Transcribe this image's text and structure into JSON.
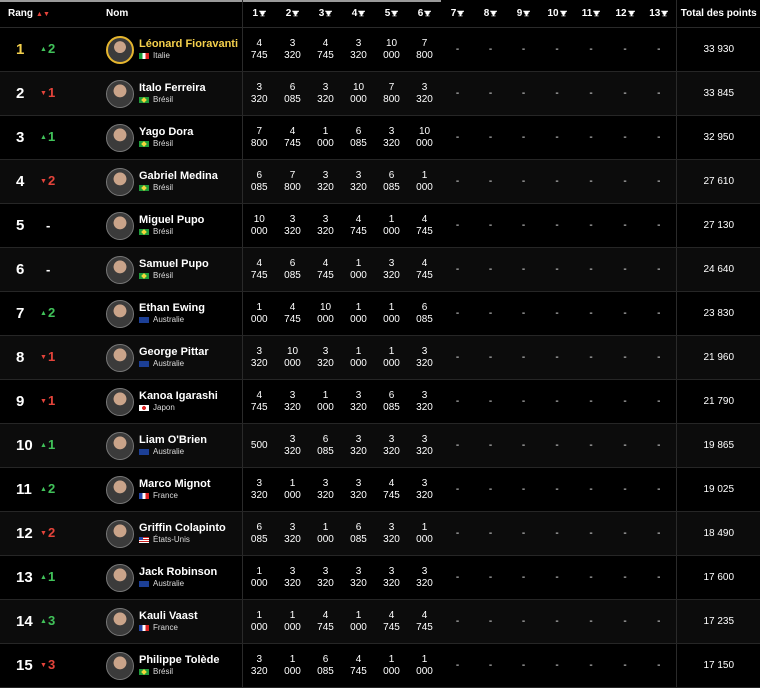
{
  "header": {
    "rang": "Rang",
    "nom": "Nom",
    "events": [
      "1",
      "2",
      "3",
      "4",
      "5",
      "6",
      "7",
      "8",
      "9",
      "10",
      "11",
      "12",
      "13"
    ],
    "total": "Total des points"
  },
  "colors": {
    "up": "#41c35a",
    "down": "#e5443b",
    "leader": "#f4d04c"
  },
  "rows": [
    {
      "rank": "1",
      "dir": "up",
      "move": "2",
      "name": "Léonard Fioravanti",
      "country": "Italie",
      "flag": "italie",
      "scores": [
        "4\n745",
        "3\n320",
        "4\n745",
        "3\n320",
        "10\n000",
        "7\n800",
        "-",
        "-",
        "-",
        "-",
        "-",
        "-",
        "-"
      ],
      "total": "33 930"
    },
    {
      "rank": "2",
      "dir": "down",
      "move": "1",
      "name": "Italo Ferreira",
      "country": "Brésil",
      "flag": "bresil",
      "scores": [
        "3\n320",
        "6\n085",
        "3\n320",
        "10\n000",
        "7\n800",
        "3\n320",
        "-",
        "-",
        "-",
        "-",
        "-",
        "-",
        "-"
      ],
      "total": "33 845"
    },
    {
      "rank": "3",
      "dir": "up",
      "move": "1",
      "name": "Yago Dora",
      "country": "Brésil",
      "flag": "bresil",
      "scores": [
        "7\n800",
        "4\n745",
        "1\n000",
        "6\n085",
        "3\n320",
        "10\n000",
        "-",
        "-",
        "-",
        "-",
        "-",
        "-",
        "-"
      ],
      "total": "32 950"
    },
    {
      "rank": "4",
      "dir": "down",
      "move": "2",
      "name": "Gabriel Medina",
      "country": "Brésil",
      "flag": "bresil",
      "scores": [
        "6\n085",
        "7\n800",
        "3\n320",
        "3\n320",
        "6\n085",
        "1\n000",
        "-",
        "-",
        "-",
        "-",
        "-",
        "-",
        "-"
      ],
      "total": "27 610"
    },
    {
      "rank": "5",
      "dir": "none",
      "move": "-",
      "name": "Miguel Pupo",
      "country": "Brésil",
      "flag": "bresil",
      "scores": [
        "10\n000",
        "3\n320",
        "3\n320",
        "4\n745",
        "1\n000",
        "4\n745",
        "-",
        "-",
        "-",
        "-",
        "-",
        "-",
        "-"
      ],
      "total": "27 130"
    },
    {
      "rank": "6",
      "dir": "none",
      "move": "-",
      "name": "Samuel Pupo",
      "country": "Brésil",
      "flag": "bresil",
      "scores": [
        "4\n745",
        "6\n085",
        "4\n745",
        "1\n000",
        "3\n320",
        "4\n745",
        "-",
        "-",
        "-",
        "-",
        "-",
        "-",
        "-"
      ],
      "total": "24 640"
    },
    {
      "rank": "7",
      "dir": "up",
      "move": "2",
      "name": "Ethan Ewing",
      "country": "Australie",
      "flag": "australie",
      "scores": [
        "1\n000",
        "4\n745",
        "10\n000",
        "1\n000",
        "1\n000",
        "6\n085",
        "-",
        "-",
        "-",
        "-",
        "-",
        "-",
        "-"
      ],
      "total": "23 830"
    },
    {
      "rank": "8",
      "dir": "down",
      "move": "1",
      "name": "George Pittar",
      "country": "Australie",
      "flag": "australie",
      "scores": [
        "3\n320",
        "10\n000",
        "3\n320",
        "1\n000",
        "1\n000",
        "3\n320",
        "-",
        "-",
        "-",
        "-",
        "-",
        "-",
        "-"
      ],
      "total": "21 960"
    },
    {
      "rank": "9",
      "dir": "down",
      "move": "1",
      "name": "Kanoa Igarashi",
      "country": "Japon",
      "flag": "japon",
      "scores": [
        "4\n745",
        "3\n320",
        "1\n000",
        "3\n320",
        "6\n085",
        "3\n320",
        "-",
        "-",
        "-",
        "-",
        "-",
        "-",
        "-"
      ],
      "total": "21 790"
    },
    {
      "rank": "10",
      "dir": "up",
      "move": "1",
      "name": "Liam O'Brien",
      "country": "Australie",
      "flag": "australie",
      "scores": [
        "500",
        "3\n320",
        "6\n085",
        "3\n320",
        "3\n320",
        "3\n320",
        "-",
        "-",
        "-",
        "-",
        "-",
        "-",
        "-"
      ],
      "total": "19 865"
    },
    {
      "rank": "11",
      "dir": "up",
      "move": "2",
      "name": "Marco Mignot",
      "country": "France",
      "flag": "france",
      "scores": [
        "3\n320",
        "1\n000",
        "3\n320",
        "3\n320",
        "4\n745",
        "3\n320",
        "-",
        "-",
        "-",
        "-",
        "-",
        "-",
        "-"
      ],
      "total": "19 025"
    },
    {
      "rank": "12",
      "dir": "down",
      "move": "2",
      "name": "Griffin Colapinto",
      "country": "États-Unis",
      "flag": "usa",
      "scores": [
        "6\n085",
        "3\n320",
        "1\n000",
        "6\n085",
        "3\n320",
        "1\n000",
        "-",
        "-",
        "-",
        "-",
        "-",
        "-",
        "-"
      ],
      "total": "18 490"
    },
    {
      "rank": "13",
      "dir": "up",
      "move": "1",
      "name": "Jack Robinson",
      "country": "Australie",
      "flag": "australie",
      "scores": [
        "1\n000",
        "3\n320",
        "3\n320",
        "3\n320",
        "3\n320",
        "3\n320",
        "-",
        "-",
        "-",
        "-",
        "-",
        "-",
        "-"
      ],
      "total": "17 600"
    },
    {
      "rank": "14",
      "dir": "up",
      "move": "3",
      "name": "Kauli Vaast",
      "country": "France",
      "flag": "france",
      "scores": [
        "1\n000",
        "1\n000",
        "4\n745",
        "1\n000",
        "4\n745",
        "4\n745",
        "-",
        "-",
        "-",
        "-",
        "-",
        "-",
        "-"
      ],
      "total": "17 235"
    },
    {
      "rank": "15",
      "dir": "down",
      "move": "3",
      "name": "Philippe Tolède",
      "country": "Brésil",
      "flag": "bresil",
      "scores": [
        "3\n320",
        "1\n000",
        "6\n085",
        "4\n745",
        "1\n000",
        "1\n000",
        "-",
        "-",
        "-",
        "-",
        "-",
        "-",
        "-"
      ],
      "total": "17 150"
    }
  ]
}
